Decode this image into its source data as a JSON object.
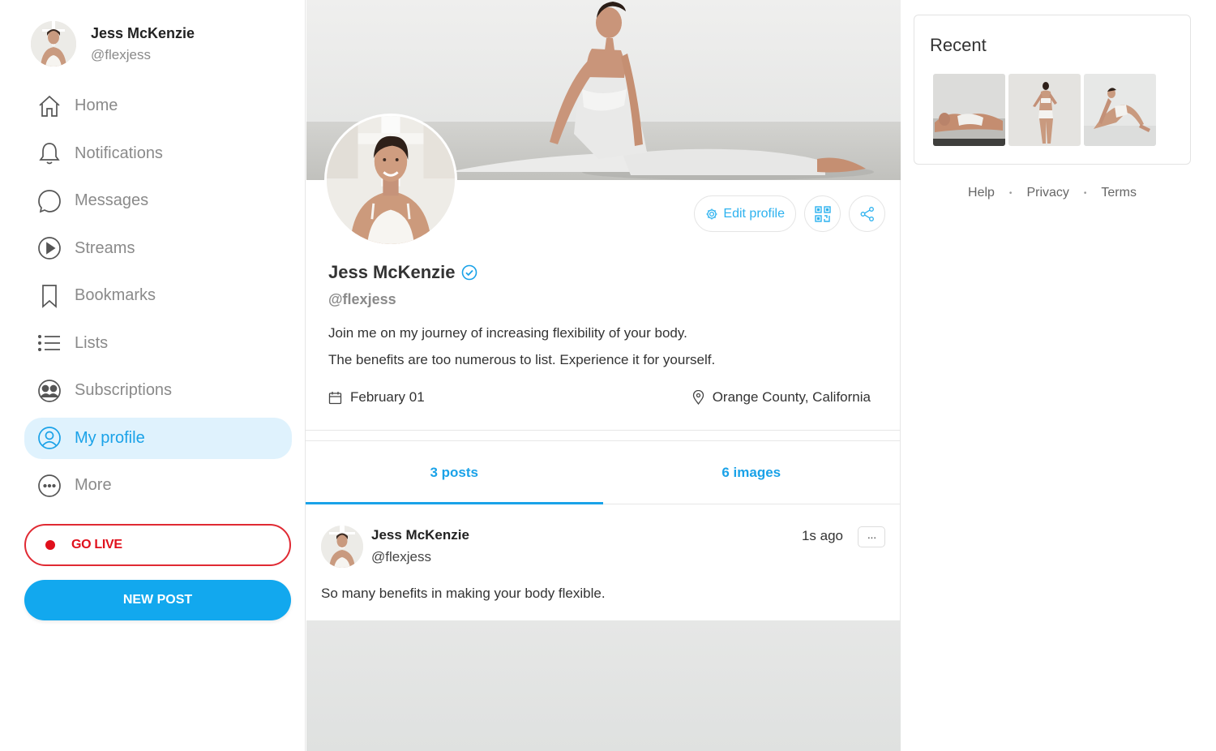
{
  "user": {
    "name": "Jess McKenzie",
    "handle": "@flexjess"
  },
  "nav": {
    "items": [
      {
        "label": "Home",
        "icon": "home-icon"
      },
      {
        "label": "Notifications",
        "icon": "bell-icon"
      },
      {
        "label": "Messages",
        "icon": "chat-bubble-icon"
      },
      {
        "label": "Streams",
        "icon": "play-circle-icon"
      },
      {
        "label": "Bookmarks",
        "icon": "bookmark-icon"
      },
      {
        "label": "Lists",
        "icon": "list-icon"
      },
      {
        "label": "Subscriptions",
        "icon": "subscriptions-icon"
      },
      {
        "label": "My profile",
        "icon": "user-circle-icon",
        "active": true
      },
      {
        "label": "More",
        "icon": "more-circle-icon"
      }
    ],
    "go_live": "GO LIVE",
    "new_post": "NEW POST"
  },
  "profile": {
    "name": "Jess McKenzie",
    "handle": "@flexjess",
    "bio_line1": "Join me on my journey of increasing flexibility of your body.",
    "bio_line2": "The benefits are too numerous to list. Experience it for yourself.",
    "joined": "February 01",
    "location": "Orange County, California",
    "edit_label": "Edit profile",
    "verified": true
  },
  "tabs": [
    {
      "label": "3 posts",
      "active": true
    },
    {
      "label": "6 images",
      "active": false
    }
  ],
  "post": {
    "author": "Jess McKenzie",
    "handle": "@flexjess",
    "time": "1s ago",
    "more": "···",
    "text": "So many benefits in making your body flexible."
  },
  "recent": {
    "title": "Recent",
    "count": 3
  },
  "footer": {
    "links": [
      "Help",
      "Privacy",
      "Terms"
    ]
  },
  "colors": {
    "accent": "#1aa2e8",
    "live": "#e0101c",
    "active_bg": "#dff2fd"
  }
}
